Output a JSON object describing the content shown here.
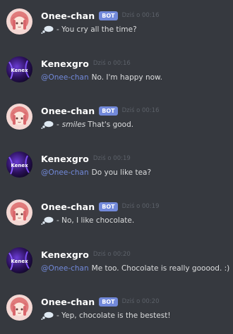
{
  "messages": [
    {
      "author": "Onee-chan",
      "bot": true,
      "bot_label": "BOT",
      "timestamp": "Dziś o 00:16",
      "emoji": "thought-balloon",
      "text": "- You cry all the time?"
    },
    {
      "author": "Kenexgro",
      "bot": false,
      "timestamp": "Dziś o 00:16",
      "mention": "@Onee-chan",
      "text": "No. I'm happy now."
    },
    {
      "author": "Onee-chan",
      "bot": true,
      "bot_label": "BOT",
      "timestamp": "Dziś o 00:16",
      "emoji": "thought-balloon",
      "prefix": "-",
      "italic": "smiles",
      "text": "That's good."
    },
    {
      "author": "Kenexgro",
      "bot": false,
      "timestamp": "Dziś o 00:19",
      "mention": "@Onee-chan",
      "text": "Do you like tea?"
    },
    {
      "author": "Onee-chan",
      "bot": true,
      "bot_label": "BOT",
      "timestamp": "Dziś o 00:19",
      "emoji": "thought-balloon",
      "text": "- No, I like chocolate."
    },
    {
      "author": "Kenexgro",
      "bot": false,
      "timestamp": "Dziś o 00:20",
      "mention": "@Onee-chan",
      "text": "Me too. Chocolate is really gooood. :)"
    },
    {
      "author": "Onee-chan",
      "bot": true,
      "bot_label": "BOT",
      "timestamp": "Dziś o 00:20",
      "emoji": "thought-balloon",
      "text": "- Yep, chocolate is the bestest!"
    }
  ],
  "colors": {
    "background": "#36393f",
    "bot_badge": "#7289da",
    "mention": "#7289da",
    "text": "#dcddde",
    "timestamp": "#5c6169"
  },
  "avatars": {
    "Onee-chan": "anime-girl-avatar",
    "Kenexgro": "kenex-logo-avatar",
    "kenex_logo_text": "Kenex"
  }
}
